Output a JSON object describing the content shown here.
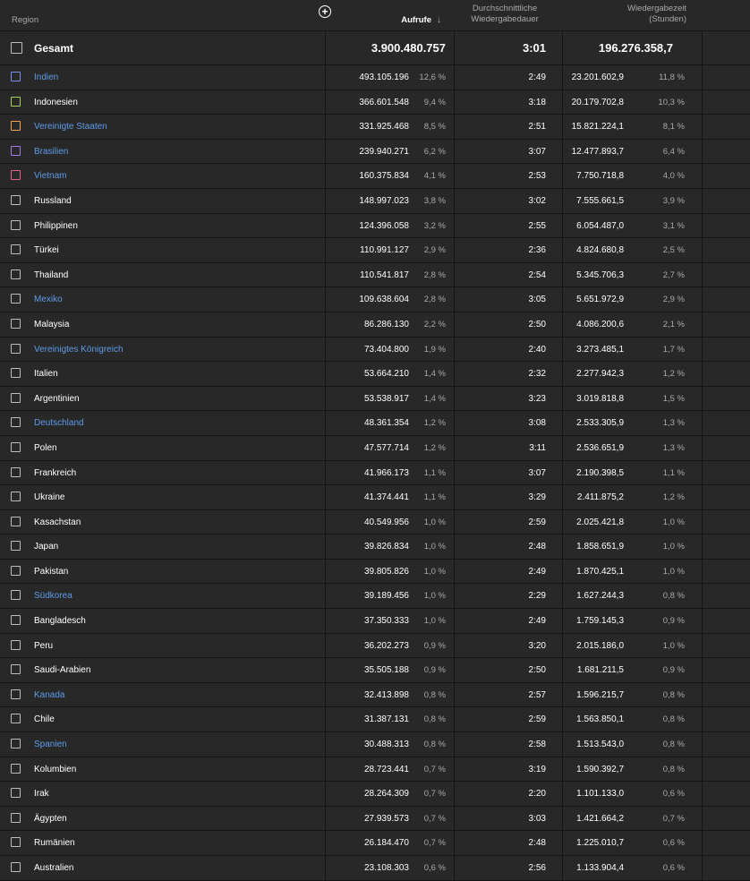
{
  "header": {
    "region": "Region",
    "views": "Aufrufe",
    "sort_arrow": "↓",
    "duration_line1": "Durchschnittliche",
    "duration_line2": "Wiedergabedauer",
    "watch_line1": "Wiedergabezeit",
    "watch_line2": "(Stunden)",
    "add_symbol": "+"
  },
  "total": {
    "name": "Gesamt",
    "views": "3.900.480.757",
    "duration": "3:01",
    "watch": "196.276.358,7"
  },
  "rows": [
    {
      "name": "Indien",
      "views": "493.105.196",
      "views_pct": "12,6 %",
      "duration": "2:49",
      "watch": "23.201.602,9",
      "watch_pct": "11,8 %",
      "color": "#7b8ef0",
      "link": true
    },
    {
      "name": "Indonesien",
      "views": "366.601.548",
      "views_pct": "9,4 %",
      "duration": "3:18",
      "watch": "20.179.702,8",
      "watch_pct": "10,3 %",
      "color": "#a8d35a",
      "link": false
    },
    {
      "name": "Vereinigte Staaten",
      "views": "331.925.468",
      "views_pct": "8,5 %",
      "duration": "2:51",
      "watch": "15.821.224,1",
      "watch_pct": "8,1 %",
      "color": "#f0a24a",
      "link": true
    },
    {
      "name": "Brasilien",
      "views": "239.940.271",
      "views_pct": "6,2 %",
      "duration": "3:07",
      "watch": "12.477.893,7",
      "watch_pct": "6,4 %",
      "color": "#a67be8",
      "link": true
    },
    {
      "name": "Vietnam",
      "views": "160.375.834",
      "views_pct": "4,1 %",
      "duration": "2:53",
      "watch": "7.750.718,8",
      "watch_pct": "4,0 %",
      "color": "#e0638f",
      "link": true
    },
    {
      "name": "Russland",
      "views": "148.997.023",
      "views_pct": "3,8 %",
      "duration": "3:02",
      "watch": "7.555.661,5",
      "watch_pct": "3,9 %",
      "color": "#bdbdbd",
      "link": false
    },
    {
      "name": "Philippinen",
      "views": "124.396.058",
      "views_pct": "3,2 %",
      "duration": "2:55",
      "watch": "6.054.487,0",
      "watch_pct": "3,1 %",
      "color": "#bdbdbd",
      "link": false
    },
    {
      "name": "Türkei",
      "views": "110.991.127",
      "views_pct": "2,9 %",
      "duration": "2:36",
      "watch": "4.824.680,8",
      "watch_pct": "2,5 %",
      "color": "#bdbdbd",
      "link": false
    },
    {
      "name": "Thailand",
      "views": "110.541.817",
      "views_pct": "2,8 %",
      "duration": "2:54",
      "watch": "5.345.706,3",
      "watch_pct": "2,7 %",
      "color": "#bdbdbd",
      "link": false
    },
    {
      "name": "Mexiko",
      "views": "109.638.604",
      "views_pct": "2,8 %",
      "duration": "3:05",
      "watch": "5.651.972,9",
      "watch_pct": "2,9 %",
      "color": "#bdbdbd",
      "link": true
    },
    {
      "name": "Malaysia",
      "views": "86.286.130",
      "views_pct": "2,2 %",
      "duration": "2:50",
      "watch": "4.086.200,6",
      "watch_pct": "2,1 %",
      "color": "#bdbdbd",
      "link": false
    },
    {
      "name": "Vereinigtes Königreich",
      "views": "73.404.800",
      "views_pct": "1,9 %",
      "duration": "2:40",
      "watch": "3.273.485,1",
      "watch_pct": "1,7 %",
      "color": "#bdbdbd",
      "link": true
    },
    {
      "name": "Italien",
      "views": "53.664.210",
      "views_pct": "1,4 %",
      "duration": "2:32",
      "watch": "2.277.942,3",
      "watch_pct": "1,2 %",
      "color": "#bdbdbd",
      "link": false
    },
    {
      "name": "Argentinien",
      "views": "53.538.917",
      "views_pct": "1,4 %",
      "duration": "3:23",
      "watch": "3.019.818,8",
      "watch_pct": "1,5 %",
      "color": "#bdbdbd",
      "link": false
    },
    {
      "name": "Deutschland",
      "views": "48.361.354",
      "views_pct": "1,2 %",
      "duration": "3:08",
      "watch": "2.533.305,9",
      "watch_pct": "1,3 %",
      "color": "#bdbdbd",
      "link": true
    },
    {
      "name": "Polen",
      "views": "47.577.714",
      "views_pct": "1,2 %",
      "duration": "3:11",
      "watch": "2.536.651,9",
      "watch_pct": "1,3 %",
      "color": "#bdbdbd",
      "link": false
    },
    {
      "name": "Frankreich",
      "views": "41.966.173",
      "views_pct": "1,1 %",
      "duration": "3:07",
      "watch": "2.190.398,5",
      "watch_pct": "1,1 %",
      "color": "#bdbdbd",
      "link": false
    },
    {
      "name": "Ukraine",
      "views": "41.374.441",
      "views_pct": "1,1 %",
      "duration": "3:29",
      "watch": "2.411.875,2",
      "watch_pct": "1,2 %",
      "color": "#bdbdbd",
      "link": false
    },
    {
      "name": "Kasachstan",
      "views": "40.549.956",
      "views_pct": "1,0 %",
      "duration": "2:59",
      "watch": "2.025.421,8",
      "watch_pct": "1,0 %",
      "color": "#bdbdbd",
      "link": false
    },
    {
      "name": "Japan",
      "views": "39.826.834",
      "views_pct": "1,0 %",
      "duration": "2:48",
      "watch": "1.858.651,9",
      "watch_pct": "1,0 %",
      "color": "#bdbdbd",
      "link": false
    },
    {
      "name": "Pakistan",
      "views": "39.805.826",
      "views_pct": "1,0 %",
      "duration": "2:49",
      "watch": "1.870.425,1",
      "watch_pct": "1,0 %",
      "color": "#bdbdbd",
      "link": false
    },
    {
      "name": "Südkorea",
      "views": "39.189.456",
      "views_pct": "1,0 %",
      "duration": "2:29",
      "watch": "1.627.244,3",
      "watch_pct": "0,8 %",
      "color": "#bdbdbd",
      "link": true
    },
    {
      "name": "Bangladesch",
      "views": "37.350.333",
      "views_pct": "1,0 %",
      "duration": "2:49",
      "watch": "1.759.145,3",
      "watch_pct": "0,9 %",
      "color": "#bdbdbd",
      "link": false
    },
    {
      "name": "Peru",
      "views": "36.202.273",
      "views_pct": "0,9 %",
      "duration": "3:20",
      "watch": "2.015.186,0",
      "watch_pct": "1,0 %",
      "color": "#bdbdbd",
      "link": false
    },
    {
      "name": "Saudi-Arabien",
      "views": "35.505.188",
      "views_pct": "0,9 %",
      "duration": "2:50",
      "watch": "1.681.211,5",
      "watch_pct": "0,9 %",
      "color": "#bdbdbd",
      "link": false
    },
    {
      "name": "Kanada",
      "views": "32.413.898",
      "views_pct": "0,8 %",
      "duration": "2:57",
      "watch": "1.596.215,7",
      "watch_pct": "0,8 %",
      "color": "#bdbdbd",
      "link": true
    },
    {
      "name": "Chile",
      "views": "31.387.131",
      "views_pct": "0,8 %",
      "duration": "2:59",
      "watch": "1.563.850,1",
      "watch_pct": "0,8 %",
      "color": "#bdbdbd",
      "link": false
    },
    {
      "name": "Spanien",
      "views": "30.488.313",
      "views_pct": "0,8 %",
      "duration": "2:58",
      "watch": "1.513.543,0",
      "watch_pct": "0,8 %",
      "color": "#bdbdbd",
      "link": true
    },
    {
      "name": "Kolumbien",
      "views": "28.723.441",
      "views_pct": "0,7 %",
      "duration": "3:19",
      "watch": "1.590.392,7",
      "watch_pct": "0,8 %",
      "color": "#bdbdbd",
      "link": false
    },
    {
      "name": "Irak",
      "views": "28.264.309",
      "views_pct": "0,7 %",
      "duration": "2:20",
      "watch": "1.101.133,0",
      "watch_pct": "0,6 %",
      "color": "#bdbdbd",
      "link": false
    },
    {
      "name": "Ägypten",
      "views": "27.939.573",
      "views_pct": "0,7 %",
      "duration": "3:03",
      "watch": "1.421.664,2",
      "watch_pct": "0,7 %",
      "color": "#bdbdbd",
      "link": false
    },
    {
      "name": "Rumänien",
      "views": "26.184.470",
      "views_pct": "0,7 %",
      "duration": "2:48",
      "watch": "1.225.010,7",
      "watch_pct": "0,6 %",
      "color": "#bdbdbd",
      "link": false
    },
    {
      "name": "Australien",
      "views": "23.108.303",
      "views_pct": "0,6 %",
      "duration": "2:56",
      "watch": "1.133.904,4",
      "watch_pct": "0,6 %",
      "color": "#bdbdbd",
      "link": false
    }
  ]
}
